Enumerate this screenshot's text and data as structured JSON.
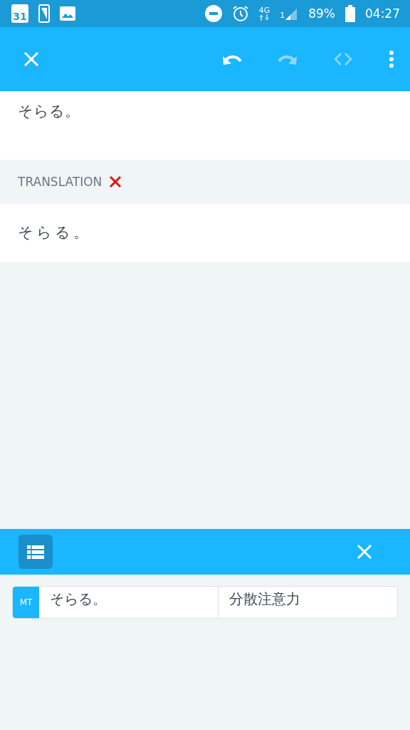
{
  "status_bar": {
    "calendar_day": "31",
    "network": "4G",
    "sim": "1",
    "battery": "89%",
    "time": "04:27"
  },
  "toolbar": {
    "buttons": [
      {
        "kind": "close",
        "disabled": false
      },
      {
        "kind": "undo",
        "disabled": false
      },
      {
        "kind": "redo",
        "disabled": true
      },
      {
        "kind": "tags",
        "disabled": true
      },
      {
        "kind": "more",
        "disabled": false
      }
    ]
  },
  "source": {
    "text": "そらる。"
  },
  "translation": {
    "label": "TRANSLATION",
    "error": true,
    "text": "そらる。"
  },
  "suggestions_bar": {
    "buttons": [
      {
        "kind": "list"
      },
      {
        "kind": "close"
      }
    ]
  },
  "suggestions": [
    {
      "badge": "MT",
      "source": "そらる。",
      "target": "分散注意力"
    }
  ]
}
